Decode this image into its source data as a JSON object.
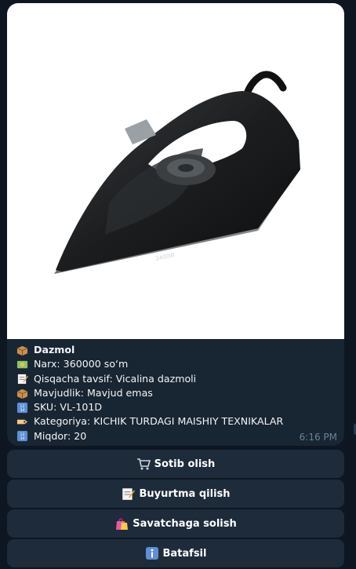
{
  "product": {
    "title": "Dazmol",
    "price": "Narx: 360000 so‘m",
    "short_desc": "Qisqacha tavsif: Vicalina dazmoli",
    "availability": "Mavjudlik: Mavjud emas",
    "sku": "SKU: VL-101D",
    "category": "Kategoriya: KICHIK TURDAGI MAISHIY TEXNIKALAR",
    "quantity": "Miqdor: 20",
    "time": "6:16 PM",
    "iron_label": "2400W"
  },
  "buttons": {
    "buy": "Sotib olish",
    "order": "Buyurtma qilish",
    "cart": "Savatchaga solish",
    "details": "Batafsil"
  },
  "colors": {
    "background": "#0e1621",
    "bubble": "#182533",
    "button": "#1d2b3a",
    "timestamp": "#6d8297"
  },
  "icons": [
    "package-icon",
    "money-icon",
    "memo-icon",
    "package-icon",
    "numbers-icon",
    "label-icon",
    "numbers-icon",
    "cart-icon",
    "memo-icon",
    "shopping-bags-icon",
    "info-icon"
  ]
}
